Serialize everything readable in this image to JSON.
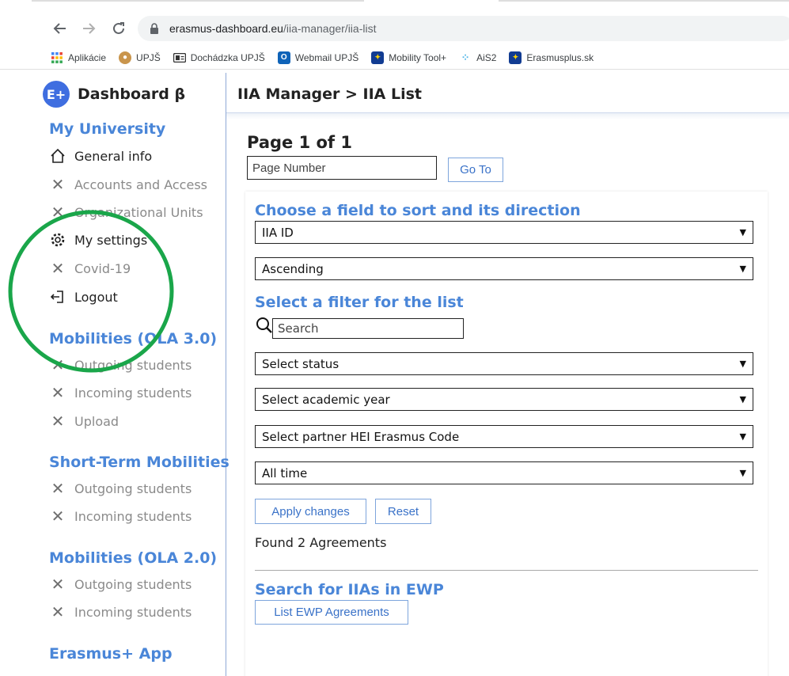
{
  "browser": {
    "url_host": "erasmus-dashboard.eu",
    "url_path": "/iia-manager/iia-list",
    "bookmarks": [
      {
        "label": "Aplikácie",
        "icon": "apps-grid-icon",
        "color": "#4285f4"
      },
      {
        "label": "UPJŠ",
        "icon": "upjs-logo-icon",
        "color": "#c9954c"
      },
      {
        "label": "Dochádzka UPJŠ",
        "icon": "attendance-card-icon",
        "color": "#333333"
      },
      {
        "label": "Webmail UPJŠ",
        "icon": "outlook-icon",
        "color": "#0f63b8"
      },
      {
        "label": "Mobility Tool+",
        "icon": "eu-flag-icon",
        "color": "#113c92"
      },
      {
        "label": "AiS2",
        "icon": "ais2-icon",
        "color": "#55b8e8"
      },
      {
        "label": "Erasmusplus.sk",
        "icon": "eu-flag-icon",
        "color": "#113c92"
      }
    ]
  },
  "brand": {
    "logo_text": "E+",
    "name": "Dashboard β",
    "color": "#3f6ee0"
  },
  "breadcrumb": "IIA Manager > IIA List",
  "sidebar": {
    "sections": [
      {
        "title": "My University",
        "items": [
          {
            "label": "General info",
            "icon": "home-icon",
            "state": "active"
          },
          {
            "label": "Accounts and Access",
            "icon": "x-icon",
            "state": "disabled"
          },
          {
            "label": "Organizational Units",
            "icon": "x-icon",
            "state": "disabled"
          },
          {
            "label": "My settings",
            "icon": "gear-icon",
            "state": "active"
          },
          {
            "label": "Covid-19",
            "icon": "x-icon",
            "state": "disabled"
          },
          {
            "label": "Logout",
            "icon": "logout-icon",
            "state": "active"
          }
        ]
      },
      {
        "title": "Mobilities (OLA 3.0)",
        "items": [
          {
            "label": "Outgoing students",
            "icon": "x-icon",
            "state": "disabled"
          },
          {
            "label": "Incoming students",
            "icon": "x-icon",
            "state": "disabled"
          },
          {
            "label": "Upload",
            "icon": "x-icon",
            "state": "disabled"
          }
        ]
      },
      {
        "title": "Short-Term Mobilities",
        "items": [
          {
            "label": "Outgoing students",
            "icon": "x-icon",
            "state": "disabled"
          },
          {
            "label": "Incoming students",
            "icon": "x-icon",
            "state": "disabled"
          }
        ]
      },
      {
        "title": "Mobilities (OLA 2.0)",
        "items": [
          {
            "label": "Outgoing students",
            "icon": "x-icon",
            "state": "disabled"
          },
          {
            "label": "Incoming students",
            "icon": "x-icon",
            "state": "disabled"
          }
        ]
      },
      {
        "title": "Erasmus+ App",
        "items": []
      }
    ]
  },
  "main": {
    "page_title": "Page 1 of 1",
    "page_number_placeholder": "Page Number",
    "goto_label": "Go To",
    "sort_heading": "Choose a field to sort and its direction",
    "sort_field": "IIA ID",
    "sort_direction": "Ascending",
    "filter_heading": "Select a filter for the list",
    "search_placeholder": "Search",
    "status_select": "Select status",
    "year_select": "Select academic year",
    "partner_select": "Select partner HEI Erasmus Code",
    "time_select": "All time",
    "apply_label": "Apply changes",
    "reset_label": "Reset",
    "found_text": "Found 2 Agreements",
    "ewp_heading": "Search for IIAs in EWP",
    "ewp_button": "List EWP Agreements"
  },
  "colors": {
    "accent": "#4a86d8",
    "annotation": "#1aa64a"
  }
}
